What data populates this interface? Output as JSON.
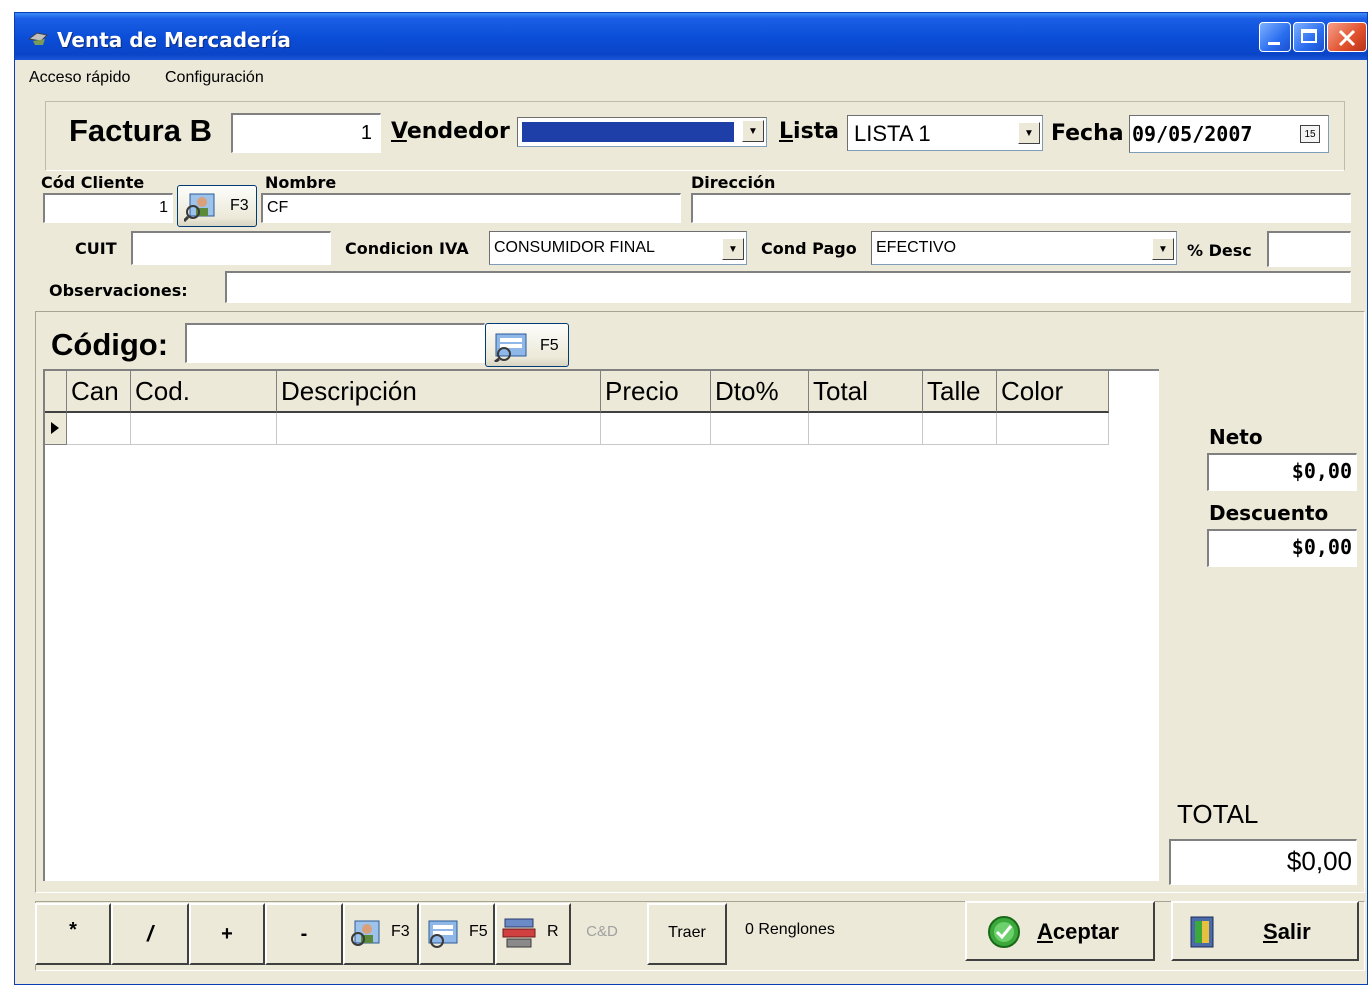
{
  "window": {
    "title": "Venta de Mercadería"
  },
  "menu": {
    "items": [
      "Acceso rápido",
      "Configuración"
    ]
  },
  "header": {
    "doc_type": "Factura B",
    "doc_number": "1",
    "vendedor_label": "Vendedor",
    "vendedor_value": "",
    "lista_label": "Lista",
    "lista_value": "LISTA 1",
    "fecha_label": "Fecha",
    "fecha_value": "09/05/2007"
  },
  "client": {
    "cod_label": "Cód Cliente",
    "cod_value": "1",
    "lookup_key": "F3",
    "nombre_label": "Nombre",
    "nombre_value": "CF",
    "direccion_label": "Dirección",
    "direccion_value": "",
    "cuit_label": "CUIT",
    "cuit_value": "",
    "iva_label": "Condicion IVA",
    "iva_value": "CONSUMIDOR FINAL",
    "pago_label": "Cond Pago",
    "pago_value": "EFECTIVO",
    "desc_label": "% Desc",
    "desc_value": "",
    "obs_label": "Observaciones:",
    "obs_value": ""
  },
  "codigo": {
    "label": "Código:",
    "value": "",
    "lookup_key": "F5"
  },
  "grid": {
    "columns": [
      "Can",
      "Cod.",
      "Descripción",
      "Precio",
      "Dto%",
      "Total",
      "Talle",
      "Color"
    ]
  },
  "totals": {
    "neto_label": "Neto",
    "neto_value": "$0,00",
    "descuento_label": "Descuento",
    "descuento_value": "$0,00",
    "total_label": "TOTAL",
    "total_value": "$0,00"
  },
  "toolbar": {
    "mult": "*",
    "div": "/",
    "plus": "+",
    "minus": "-",
    "f3": "F3",
    "f5": "F5",
    "r": "R",
    "cd": "C&D",
    "traer": "Traer",
    "renglones": "0 Renglones",
    "aceptar": "Aceptar",
    "salir": "Salir"
  },
  "colors": {
    "title_blue": "#0b4ed8",
    "face": "#ece9d8",
    "vendedor_fill": "#1f3fa8"
  }
}
